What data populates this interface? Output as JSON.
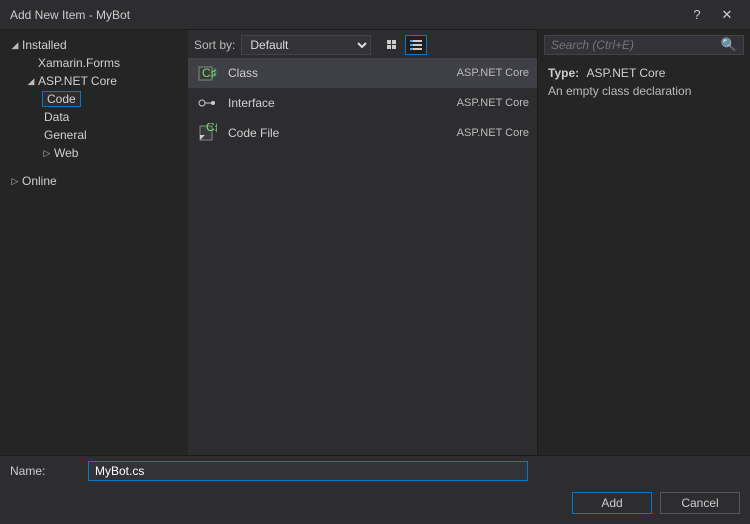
{
  "window": {
    "title": "Add New Item - MyBot",
    "help": "?",
    "close": "✕"
  },
  "tree": {
    "installed": "Installed",
    "xamarin": "Xamarin.Forms",
    "aspnet": "ASP.NET Core",
    "code": "Code",
    "data": "Data",
    "general": "General",
    "web": "Web",
    "online": "Online"
  },
  "sort": {
    "label": "Sort by:",
    "value": "Default"
  },
  "items": [
    {
      "label": "Class",
      "tag": "ASP.NET Core"
    },
    {
      "label": "Interface",
      "tag": "ASP.NET Core"
    },
    {
      "label": "Code File",
      "tag": "ASP.NET Core"
    }
  ],
  "search": {
    "placeholder": "Search (Ctrl+E)"
  },
  "details": {
    "typelabel": "Type:",
    "typevalue": "ASP.NET Core",
    "description": "An empty class declaration"
  },
  "name": {
    "label": "Name:",
    "value": "MyBot.cs"
  },
  "buttons": {
    "add": "Add",
    "cancel": "Cancel"
  }
}
